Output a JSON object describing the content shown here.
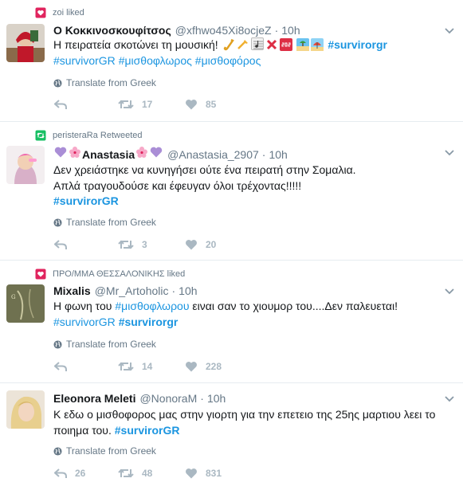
{
  "tweets": [
    {
      "context": "zoi liked",
      "context_type": "like",
      "name": "Ο Κοκκινοσκουφίτσος",
      "handle": "@xfhwo45Xi8ocjeZ",
      "time": "10h",
      "text_line1": "Η πειρατεία σκοτώνει τη μουσική!",
      "hashtag_inline": "#survirorgr",
      "hashtags_line2": [
        "#survivorGR",
        "#μισθοφλωρος",
        "#μισθοφόρος"
      ],
      "emoji_icons": [
        "saxophone-emoji",
        "trumpet-emoji",
        "musical-score-emoji",
        "cross-mark-emoji",
        "sos-emoji",
        "beach-emoji",
        "umbrella-beach-emoji"
      ],
      "translate": "Translate from Greek",
      "retweets": "17",
      "likes": "85"
    },
    {
      "context": "peristeraRa Retweeted",
      "context_type": "retweet",
      "name_core": "Anastasia",
      "name_emojis": [
        "purple-heart-emoji",
        "cherry-blossom-emoji"
      ],
      "handle": "@Anastasia_2907",
      "time": "10h",
      "text_line1": "Δεν χρειάστηκε να κυνηγήσει ούτε ένα πειρατή στην Σομαλια.",
      "text_line2": "Απλά τραγουδούσε και έφευγαν όλοι τρέχοντας!!!!!",
      "hashtag": "#survirorGR",
      "translate": "Translate from Greek",
      "retweets": "3",
      "likes": "20"
    },
    {
      "context": "ΠΡΟ/ΜΜΑ ΘΕΣΣΑΛΟΝΙΚΗΣ liked",
      "context_type": "like",
      "name": "Mixalis",
      "handle": "@Mr_Artoholic",
      "time": "10h",
      "text_pre": "Η φωνη του",
      "text_hashtag": "#μισθοφλωρου",
      "text_post": "ειναι σαν το χιουμορ του....Δεν παλευεται!",
      "hashtags_line2": [
        "#survivorGR",
        "#survirorgr"
      ],
      "translate": "Translate from Greek",
      "retweets": "14",
      "likes": "228"
    },
    {
      "name": "Eleonora Meleti",
      "handle": "@NonoraM",
      "time": "10h",
      "text_line1": "Κ εδω ο μισθοφορος μας στην γιορτη για την επετειο της 25ης μαρτιου λεει το",
      "text_line2": "ποιημα του.",
      "hashtag": "#survirorGR",
      "translate": "Translate from Greek",
      "replies": "26",
      "retweets": "48",
      "likes": "831"
    }
  ],
  "colors": {
    "link": "#1b95e0",
    "muted": "#657786",
    "action": "#aab8c2",
    "like_badge": "#e0245e",
    "retweet_badge": "#17bf63"
  }
}
